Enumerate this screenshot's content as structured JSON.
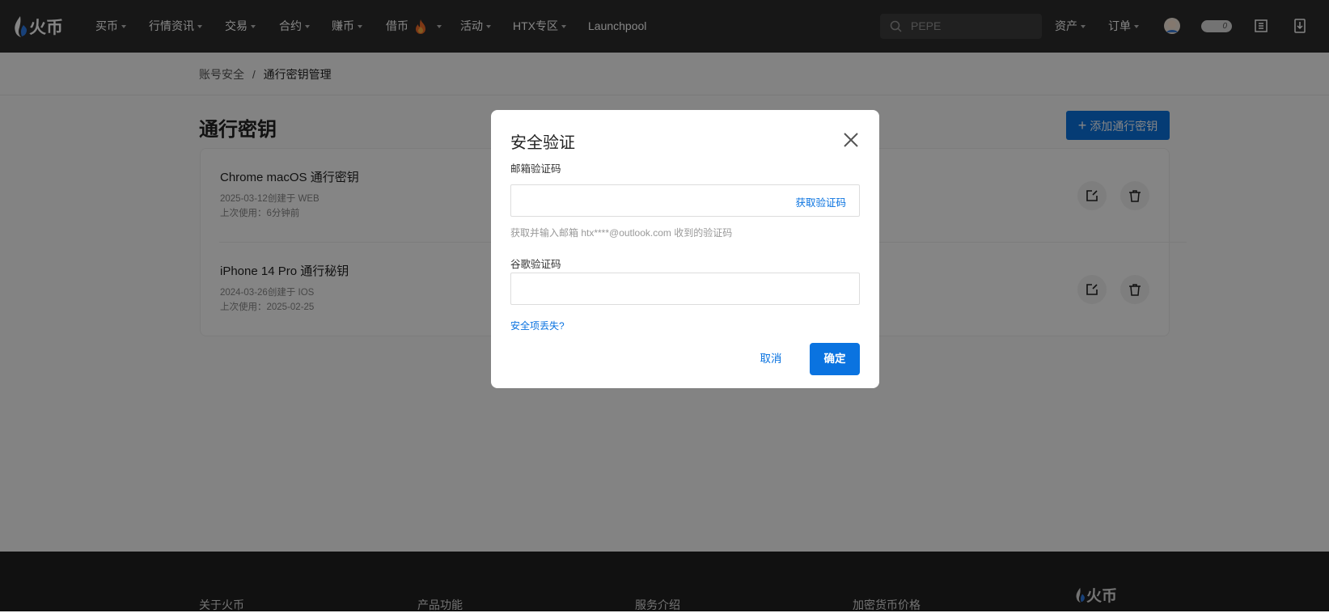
{
  "header": {
    "logo_text": "火币",
    "nav": [
      {
        "label": "买币",
        "caret": true
      },
      {
        "label": "行情资讯",
        "caret": true
      },
      {
        "label": "交易",
        "caret": true
      },
      {
        "label": "合约",
        "caret": true
      },
      {
        "label": "赚币",
        "caret": true
      },
      {
        "label": "借币",
        "caret": true,
        "icon": "fire-icon"
      },
      {
        "label": "活动",
        "caret": true
      },
      {
        "label": "HTX专区",
        "caret": true
      },
      {
        "label": "Launchpool",
        "caret": false
      }
    ],
    "search_placeholder": "PEPE",
    "assets_label": "资产",
    "orders_label": "订单",
    "toggle_value": "0"
  },
  "breadcrumb": {
    "parent": "账号安全",
    "separator": "/",
    "current": "通行密钥管理"
  },
  "page_title": "通行密钥",
  "add_button": "添加通行密钥",
  "passkeys": [
    {
      "name": "Chrome macOS 通行密钥",
      "created": "2025-03-12创建于 WEB",
      "last_used": "上次使用：6分钟前"
    },
    {
      "name": "iPhone 14 Pro 通行秘钥",
      "created": "2024-03-26创建于 IOS",
      "last_used": "上次使用：2025-02-25"
    }
  ],
  "footer": {
    "cols": [
      "关于火币",
      "产品功能",
      "服务介绍",
      "加密货币价格"
    ],
    "logo_text": "火币"
  },
  "dialog": {
    "title": "安全验证",
    "email_label": "邮箱验证码",
    "get_code": "获取验证码",
    "email_hint": "获取并输入邮箱 htx****@outlook.com 收到的验证码",
    "google_label": "谷歌验证码",
    "lost_link": "安全项丢失?",
    "cancel": "取消",
    "confirm": "确定"
  },
  "colors": {
    "accent": "#0a73e0",
    "header_bg": "#2c2c2c"
  }
}
